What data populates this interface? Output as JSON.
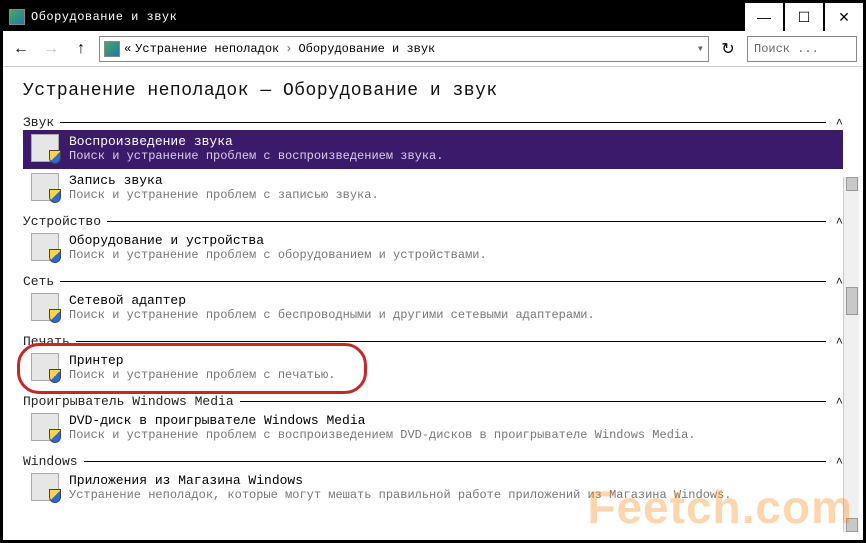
{
  "window": {
    "title": "Оборудование и звук"
  },
  "nav": {
    "crumb_prefix": "«",
    "crumb1": "Устранение неполадок",
    "crumb2": "Оборудование и звук"
  },
  "search": {
    "placeholder": "Поиск ..."
  },
  "page": {
    "title": "Устранение неполадок — Оборудование и звук"
  },
  "groups": [
    {
      "label": "Звук",
      "items": [
        {
          "name": "Воспроизведение звука",
          "desc": "Поиск и устранение проблем с воспроизведением звука.",
          "selected": true
        },
        {
          "name": "Запись звука",
          "desc": "Поиск и устранение проблем с записью звука."
        }
      ]
    },
    {
      "label": "Устройство",
      "items": [
        {
          "name": "Оборудование и устройства",
          "desc": "Поиск и устранение проблем с оборудованием и устройствами."
        }
      ]
    },
    {
      "label": "Сеть",
      "items": [
        {
          "name": "Сетевой адаптер",
          "desc": "Поиск и устранение проблем с беспроводными и другими сетевыми адаптерами."
        }
      ]
    },
    {
      "label": "Печать",
      "items": [
        {
          "name": "Принтер",
          "desc": "Поиск и устранение проблем с печатью.",
          "highlighted": true
        }
      ]
    },
    {
      "label": "Проигрыватель Windows Media",
      "items": [
        {
          "name": "DVD-диск в проигрывателе Windows Media",
          "desc": "Поиск и устранение проблем с воспроизведением DVD-дисков в проигрывателе Windows Media."
        }
      ]
    },
    {
      "label": "Windows",
      "items": [
        {
          "name": "Приложения из Магазина Windows",
          "desc": "Устранение неполадок, которые могут мешать правильной работе приложений из Магазина Windows."
        }
      ]
    }
  ],
  "watermark": "Feetch.com"
}
